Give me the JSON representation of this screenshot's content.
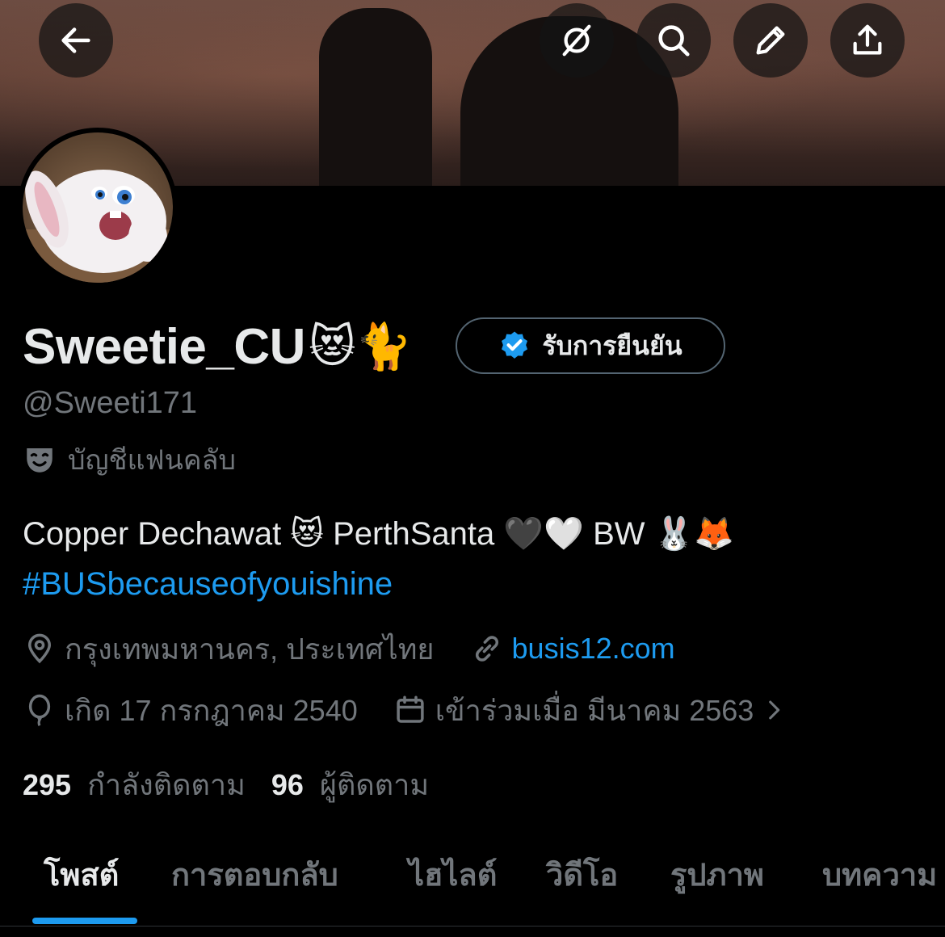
{
  "header": {
    "back_icon": "arrow-left-icon",
    "actions": [
      "slash-circle-icon",
      "search-icon",
      "edit-pencil-icon",
      "share-icon"
    ]
  },
  "profile": {
    "display_name": "Sweetie_CU",
    "name_emojis": "😻🐈",
    "verify_label": "รับการยืนยัน",
    "handle": "@Sweeti171",
    "account_type": "บัญชีแฟนคลับ",
    "bio_line1": "Copper Dechawat 😻 PerthSanta 🖤🤍 BW 🐰🦊",
    "hashtag": "#BUSbecauseofyouishine",
    "location": "กรุงเทพมหานคร, ประเทศไทย",
    "website": "busis12.com",
    "birthday": "เกิด 17 กรกฎาคม 2540",
    "joined": "เข้าร่วมเมื่อ มีนาคม 2563",
    "following_count": "295",
    "following_label": "กำลังติดตาม",
    "followers_count": "96",
    "followers_label": "ผู้ติดตาม"
  },
  "tabs": [
    "โพสต์",
    "การตอบกลับ",
    "ไฮไลต์",
    "วิดีโอ",
    "รูปภาพ",
    "บทความ"
  ],
  "colors": {
    "accent": "#1d9bf0",
    "muted": "#71767b",
    "text": "#e7e9ea",
    "background": "#000000"
  }
}
